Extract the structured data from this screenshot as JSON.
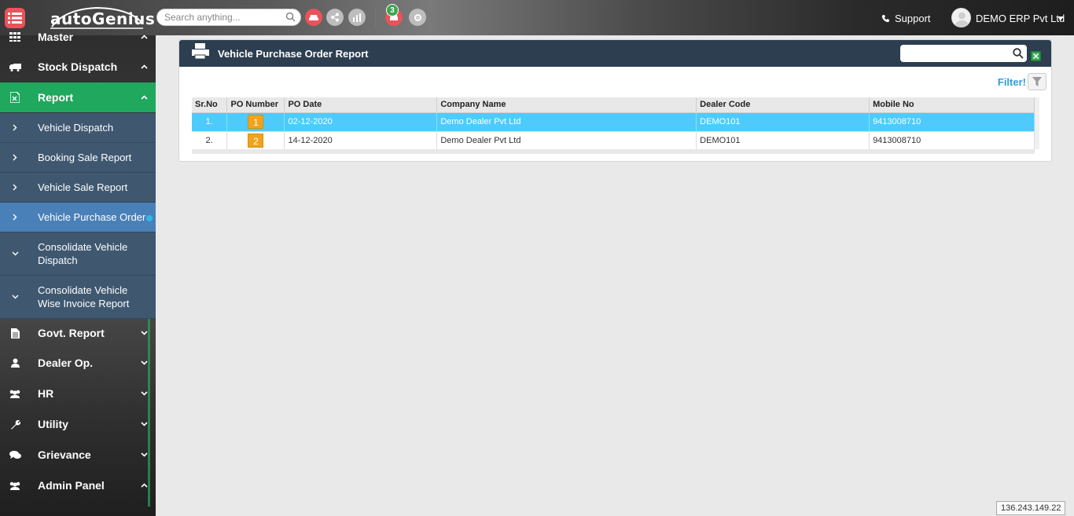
{
  "header": {
    "brand": "autoGenius",
    "search_placeholder": "Search anything...",
    "notification_count": "3",
    "support_label": "Support",
    "user_name": "DEMO ERP Pvt Ltd"
  },
  "sidebar": {
    "items": [
      {
        "label": "Master",
        "icon": "grid-icon"
      },
      {
        "label": "Stock Dispatch",
        "icon": "truck-icon"
      },
      {
        "label": "Report",
        "icon": "excel-file-icon",
        "active": true
      },
      {
        "label": "Govt. Report",
        "icon": "document-icon"
      },
      {
        "label": "Dealer Op.",
        "icon": "user-icon"
      },
      {
        "label": "HR",
        "icon": "users-icon"
      },
      {
        "label": "Utility",
        "icon": "wrench-icon"
      },
      {
        "label": "Grievance",
        "icon": "chat-icon"
      },
      {
        "label": "Admin Panel",
        "icon": "users-icon"
      }
    ],
    "report_sub": [
      {
        "label": "Vehicle Dispatch"
      },
      {
        "label": "Booking Sale Report"
      },
      {
        "label": "Vehicle Sale Report"
      },
      {
        "label": "Vehicle Purchase Order",
        "current": true
      },
      {
        "label": "Consolidate Vehicle Dispatch"
      },
      {
        "label": "Consolidate Vehicle Wise Invoice Report"
      }
    ]
  },
  "panel": {
    "title": "Vehicle Purchase Order Report",
    "filter_label": "Filter!",
    "columns": [
      "Sr.No",
      "PO Number",
      "PO Date",
      "Company Name",
      "Dealer Code",
      "Mobile No"
    ],
    "rows": [
      {
        "sr": "1.",
        "po": "1",
        "date": "02-12-2020",
        "company": "Demo Dealer Pvt Ltd",
        "dealer": "DEMO101",
        "mobile": "9413008710",
        "selected": true
      },
      {
        "sr": "2.",
        "po": "2",
        "date": "14-12-2020",
        "company": "Demo Dealer Pvt Ltd",
        "dealer": "DEMO101",
        "mobile": "9413008710",
        "selected": false
      }
    ]
  },
  "footer": {
    "ip": "136.243.149.22"
  },
  "colors": {
    "active_green": "#1fa85e",
    "selected_row": "#4ecbfc",
    "header_navy": "#2c3e50",
    "po_badge": "#f0a41c"
  }
}
